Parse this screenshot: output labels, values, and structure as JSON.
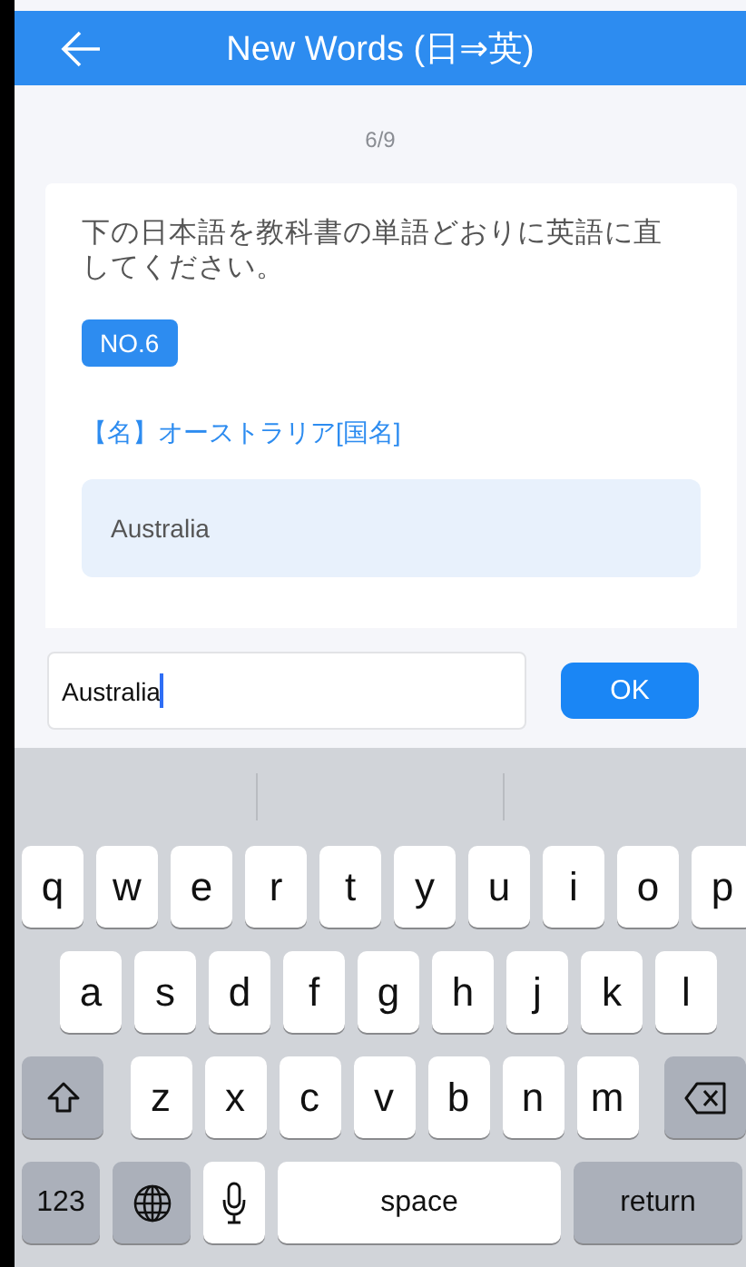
{
  "header": {
    "title": "New Words (日⇒英)"
  },
  "progress": "6/9",
  "card": {
    "instruction": "下の日本語を教科書の単語どおりに英語に直してください。",
    "badge": "NO.6",
    "prompt": "【名】オーストラリア[国名]",
    "answer": "Australia"
  },
  "answer_input": {
    "value": "Australia",
    "focused": true
  },
  "ok_button": "OK",
  "keyboard": {
    "rows": [
      {
        "keys": [
          {
            "kind": "letter",
            "label": "q"
          },
          {
            "kind": "letter",
            "label": "w"
          },
          {
            "kind": "letter",
            "label": "e"
          },
          {
            "kind": "letter",
            "label": "r"
          },
          {
            "kind": "letter",
            "label": "t"
          },
          {
            "kind": "letter",
            "label": "y"
          },
          {
            "kind": "letter",
            "label": "u"
          },
          {
            "kind": "letter",
            "label": "i"
          },
          {
            "kind": "letter",
            "label": "o"
          },
          {
            "kind": "letter",
            "label": "p"
          }
        ]
      },
      {
        "keys": [
          {
            "kind": "letter",
            "label": "a"
          },
          {
            "kind": "letter",
            "label": "s"
          },
          {
            "kind": "letter",
            "label": "d"
          },
          {
            "kind": "letter",
            "label": "f"
          },
          {
            "kind": "letter",
            "label": "g"
          },
          {
            "kind": "letter",
            "label": "h"
          },
          {
            "kind": "letter",
            "label": "j"
          },
          {
            "kind": "letter",
            "label": "k"
          },
          {
            "kind": "letter",
            "label": "l"
          }
        ]
      },
      {
        "keys": [
          {
            "kind": "shift"
          },
          {
            "kind": "letter",
            "label": "z"
          },
          {
            "kind": "letter",
            "label": "x"
          },
          {
            "kind": "letter",
            "label": "c"
          },
          {
            "kind": "letter",
            "label": "v"
          },
          {
            "kind": "letter",
            "label": "b"
          },
          {
            "kind": "letter",
            "label": "n"
          },
          {
            "kind": "letter",
            "label": "m"
          },
          {
            "kind": "delete"
          }
        ]
      },
      {
        "keys": [
          {
            "kind": "mode",
            "label": "123"
          },
          {
            "kind": "globe"
          },
          {
            "kind": "mic"
          },
          {
            "kind": "space",
            "label": "space"
          },
          {
            "kind": "return",
            "label": "return"
          }
        ]
      }
    ]
  }
}
